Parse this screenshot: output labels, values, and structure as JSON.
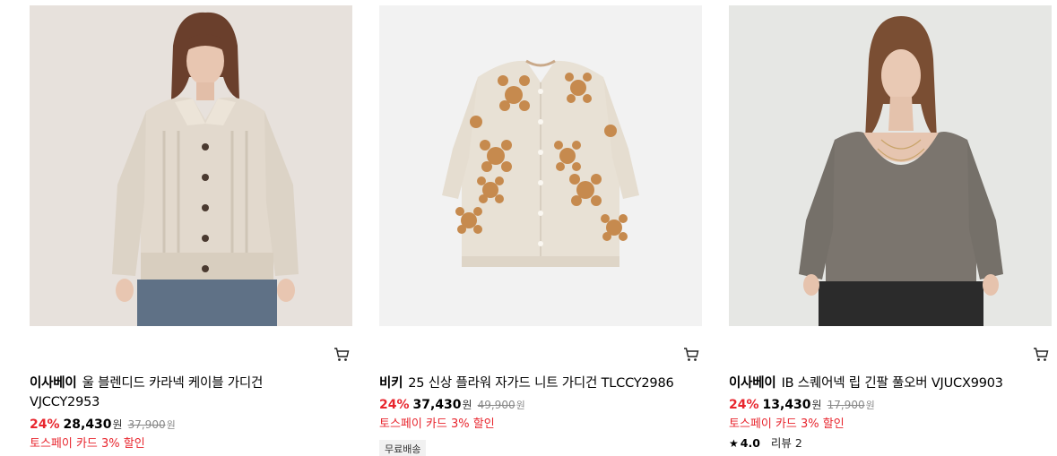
{
  "products": [
    {
      "brand": "이사베이",
      "name_line1": "울 블렌디드 카라넥 케이블 가디건",
      "name_line2": "VJCCY2953",
      "discount": "24%",
      "price": "28,430",
      "currency": "원",
      "original_price": "37,900",
      "promo": "토스페이 카드 3% 할인",
      "cart_icon": "shopping-cart-icon"
    },
    {
      "brand": "비키",
      "name_line1": "25 신상 플라워 자가드 니트 가디건 TLCCY2986",
      "discount": "24%",
      "price": "37,430",
      "currency": "원",
      "original_price": "49,900",
      "promo": "토스페이 카드 3% 할인",
      "tag": "무료배송",
      "cart_icon": "shopping-cart-icon"
    },
    {
      "brand": "이사베이",
      "name_line1": "IB 스퀘어넥 립 긴팔 풀오버 VJUCX9903",
      "discount": "24%",
      "price": "13,430",
      "currency": "원",
      "original_price": "17,900",
      "promo": "토스페이 카드 3% 할인",
      "rating_icon": "star-icon",
      "rating": "4.0",
      "reviews": "리뷰 2",
      "cart_icon": "shopping-cart-icon"
    }
  ]
}
